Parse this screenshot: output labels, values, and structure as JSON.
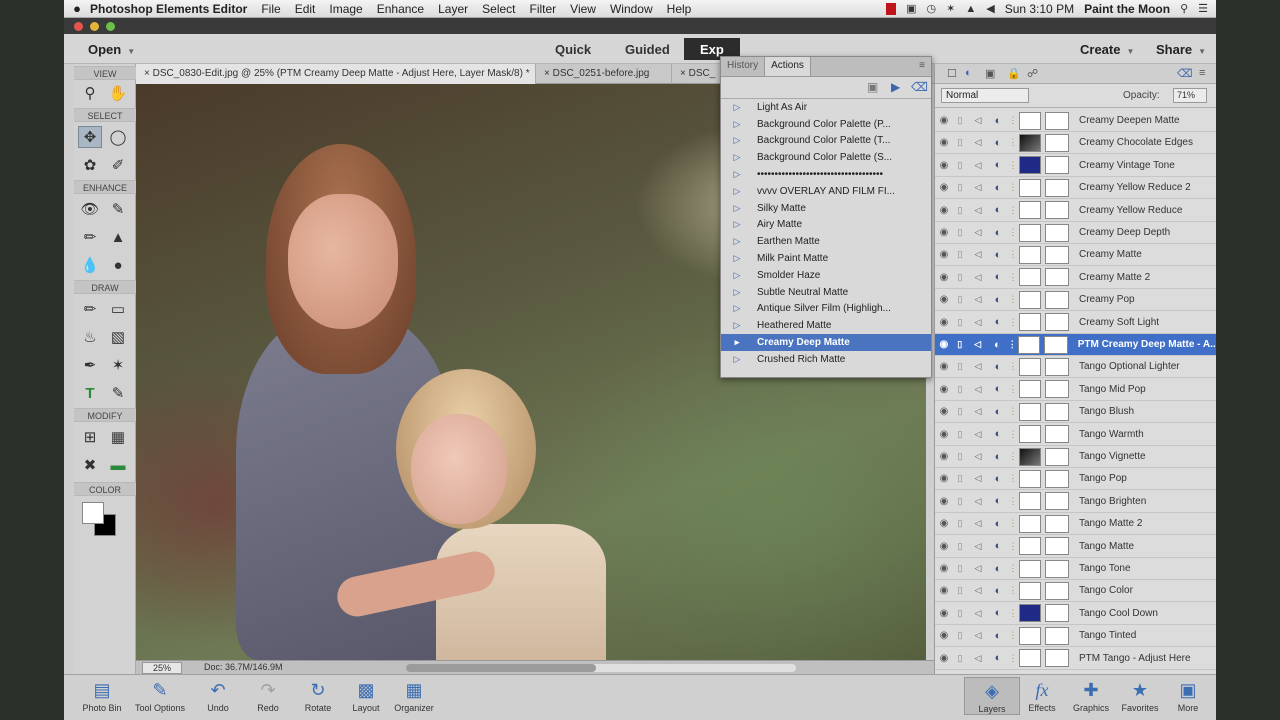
{
  "menubar": {
    "apple": "",
    "app_name": "Photoshop Elements Editor",
    "items": [
      "File",
      "Edit",
      "Image",
      "Enhance",
      "Layer",
      "Select",
      "Filter",
      "View",
      "Window",
      "Help"
    ],
    "clock": "Sun 3:10 PM",
    "user": "Paint the Moon",
    "status_icons": [
      "record-icon",
      "display-icon",
      "timemachine-icon",
      "bluetooth-icon",
      "wifi-icon",
      "volume-icon",
      "search-icon",
      "list-icon"
    ]
  },
  "modebar": {
    "open_label": "Open",
    "modes": [
      "Quick",
      "Guided",
      "Exp"
    ],
    "active_mode": "Exp",
    "create_label": "Create",
    "share_label": "Share"
  },
  "toolbox": {
    "sections": [
      "VIEW",
      "SELECT",
      "ENHANCE",
      "DRAW",
      "MODIFY",
      "COLOR"
    ],
    "foreground_color": "#ffffff",
    "background_color": "#000000"
  },
  "doc_tabs": [
    "DSC_0830-Edit.jpg @ 25% (PTM Creamy Deep Matte - Adjust Here, Layer Mask/8) *",
    "DSC_0251-before.jpg",
    "DSC_"
  ],
  "status": {
    "zoom": "25%",
    "doc": "Doc: 36.7M/146.9M"
  },
  "actions_panel": {
    "tabs": [
      "History",
      "Actions"
    ],
    "active_tab": "Actions",
    "items": [
      "Light As Air",
      "Background Color Palette (P...",
      "Background Color Palette (T...",
      "Background Color Palette (S...",
      "••••••••••••••••••••••••••••••••••••",
      "vvvv  OVERLAY AND FILM FI...",
      "Silky Matte",
      "Airy Matte",
      "Earthen Matte",
      "Milk Paint Matte",
      "Smolder Haze",
      "Subtle Neutral Matte",
      "Antique Silver Film (Highligh...",
      "Heathered Matte",
      "Creamy Deep Matte",
      "Crushed Rich Matte"
    ],
    "selected_item": "Creamy Deep Matte"
  },
  "layers_panel": {
    "blend_mode": "Normal",
    "opacity_label": "Opacity:",
    "opacity_value": "71%",
    "layers": [
      {
        "name": "Creamy Deepen Matte",
        "thumb": "white"
      },
      {
        "name": "Creamy Chocolate Edges",
        "thumb": "dark"
      },
      {
        "name": "Creamy Vintage Tone",
        "thumb": "navy"
      },
      {
        "name": "Creamy Yellow Reduce 2",
        "thumb": "white"
      },
      {
        "name": "Creamy Yellow Reduce",
        "thumb": "white"
      },
      {
        "name": "Creamy Deep Depth",
        "thumb": "white"
      },
      {
        "name": "Creamy Matte",
        "thumb": "white"
      },
      {
        "name": "Creamy Matte 2",
        "thumb": "white"
      },
      {
        "name": "Creamy Pop",
        "thumb": "white"
      },
      {
        "name": "Creamy Soft Light",
        "thumb": "white"
      },
      {
        "name": "PTM Creamy Deep Matte - A...",
        "thumb": "white"
      },
      {
        "name": "Tango Optional Lighter",
        "thumb": "white"
      },
      {
        "name": "Tango Mid Pop",
        "thumb": "white"
      },
      {
        "name": "Tango Blush",
        "thumb": "white"
      },
      {
        "name": "Tango Warmth",
        "thumb": "white"
      },
      {
        "name": "Tango Vignette",
        "thumb": "dark"
      },
      {
        "name": "Tango Pop",
        "thumb": "white"
      },
      {
        "name": "Tango Brighten",
        "thumb": "white"
      },
      {
        "name": "Tango Matte 2",
        "thumb": "white"
      },
      {
        "name": "Tango Matte",
        "thumb": "white"
      },
      {
        "name": "Tango Tone",
        "thumb": "white"
      },
      {
        "name": "Tango Color",
        "thumb": "white"
      },
      {
        "name": "Tango Cool Down",
        "thumb": "navy"
      },
      {
        "name": "Tango Tinted",
        "thumb": "white"
      },
      {
        "name": "PTM Tango - Adjust Here",
        "thumb": "white"
      }
    ],
    "selected_layer": "PTM Creamy Deep Matte - A..."
  },
  "bottombar": {
    "left_items": [
      "Photo Bin",
      "Tool Options",
      "Undo",
      "Redo",
      "Rotate",
      "Layout",
      "Organizer"
    ],
    "right_items": [
      "Layers",
      "Effects",
      "Graphics",
      "Favorites",
      "More"
    ],
    "selected": "Layers"
  },
  "colors": {
    "selection_blue": "#3f6fc6",
    "action_selection": "#4a74bf",
    "accent_icon": "#3b6db2"
  }
}
